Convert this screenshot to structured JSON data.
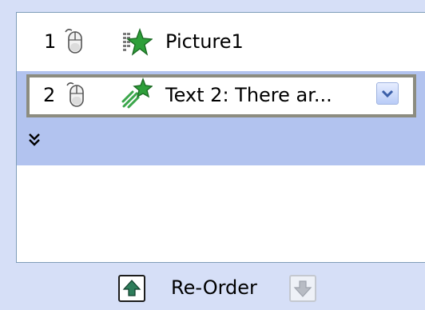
{
  "animation_list": {
    "items": [
      {
        "number": "1",
        "trigger_icon": "mouse-icon",
        "effect_icon": "entrance-effect-icon",
        "label": "Picture1",
        "selected": false
      },
      {
        "number": "2",
        "trigger_icon": "mouse-icon",
        "effect_icon": "fly-in-effect-icon",
        "label": "Text 2: There ar...",
        "selected": true,
        "dropdown_icon": "chevron-down-icon"
      }
    ],
    "expand_icon": "double-chevron-down-icon"
  },
  "reorder": {
    "label": "Re-Order",
    "up_icon": "arrow-up-icon",
    "down_icon": "arrow-down-icon",
    "down_enabled": false
  },
  "colors": {
    "pane_background": "#d6dff7",
    "selection": "#b2c3ef",
    "focus_border": "#8c8c80",
    "list_border": "#7f9db9",
    "effect_green": "#2e9f3a"
  }
}
